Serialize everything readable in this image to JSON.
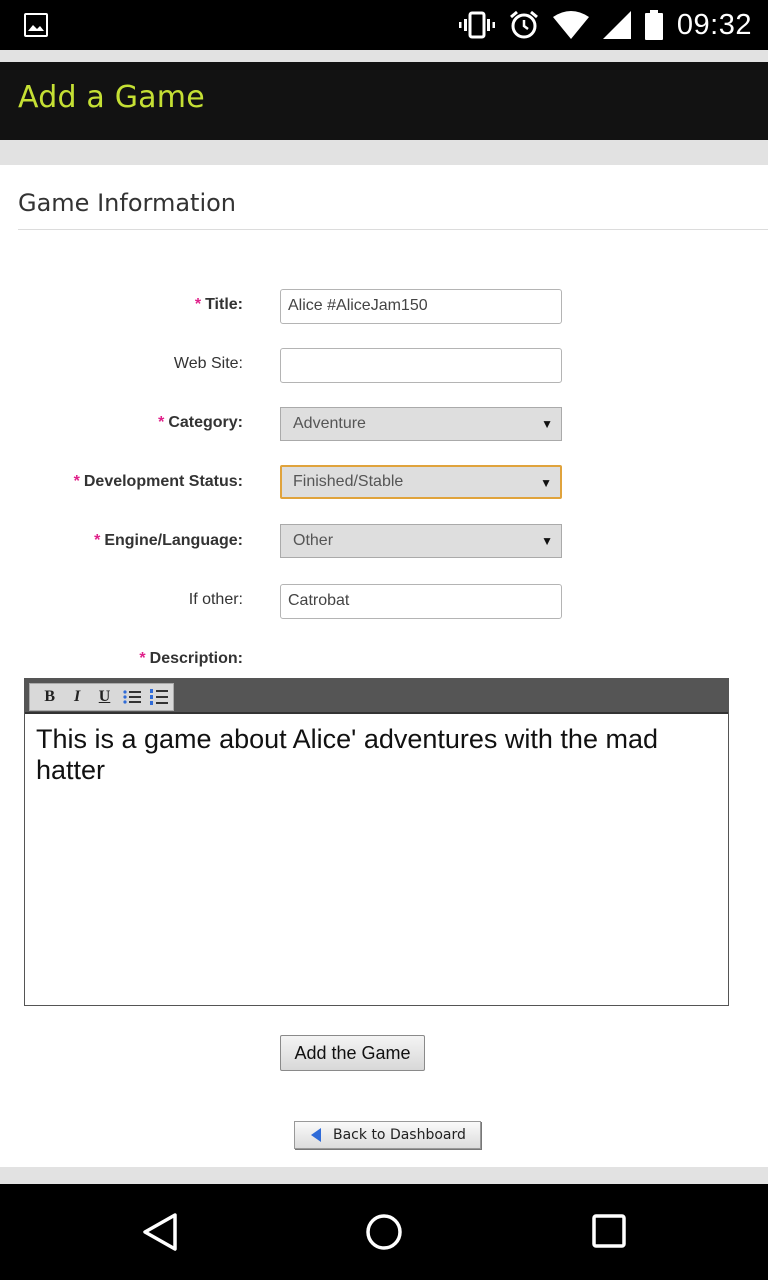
{
  "status_bar": {
    "time": "09:32",
    "icons": [
      "gallery-icon",
      "vibrate-icon",
      "alarm-icon",
      "wifi-icon",
      "signal-icon",
      "battery-icon"
    ]
  },
  "header": {
    "title": "Add a Game",
    "title_color": "#c5e034",
    "background": "#121212"
  },
  "form": {
    "section_title": "Game Information",
    "required_marker": "*",
    "fields": {
      "title": {
        "label": "Title:",
        "value": "Alice #AliceJam150"
      },
      "website": {
        "label": "Web Site:",
        "value": ""
      },
      "category": {
        "label": "Category:",
        "value": "Adventure"
      },
      "dev_status": {
        "label": "Development Status:",
        "value": "Finished/Stable"
      },
      "engine": {
        "label": "Engine/Language:",
        "value": "Other"
      },
      "if_other": {
        "label": "If other:",
        "value": "Catrobat"
      },
      "description": {
        "label": "Description:",
        "value": "This is a game about Alice' adventures with the mad hatter"
      }
    },
    "toolbar": {
      "bold": "B",
      "italic": "I",
      "underline": "U",
      "icons": [
        "bold-icon",
        "italic-icon",
        "underline-icon",
        "bullet-list-icon",
        "numbered-list-icon"
      ]
    },
    "submit_label": "Add the Game",
    "back_label": "Back to Dashboard"
  },
  "nav_bar": {
    "icons": [
      "back-icon",
      "home-icon",
      "recents-icon"
    ]
  },
  "colors": {
    "required": "#e0218a",
    "focus_border": "#e0a33c",
    "back_arrow": "#2f6bd8"
  }
}
